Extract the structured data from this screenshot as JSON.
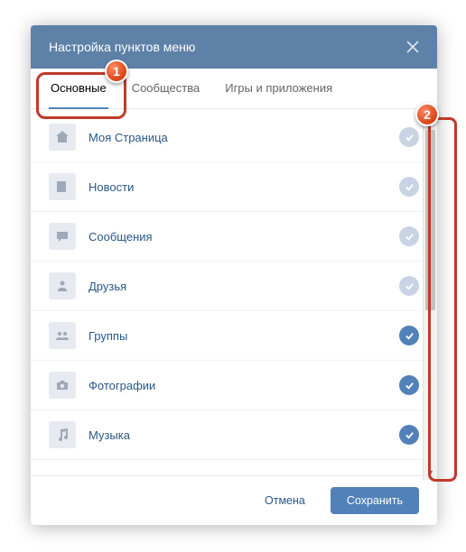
{
  "header": {
    "title": "Настройка пунктов меню"
  },
  "tabs": [
    {
      "label": "Основные",
      "active": true
    },
    {
      "label": "Сообщества",
      "active": false
    },
    {
      "label": "Игры и приложения",
      "active": false
    }
  ],
  "items": [
    {
      "label": "Моя Страница",
      "icon": "home",
      "state": "locked"
    },
    {
      "label": "Новости",
      "icon": "news",
      "state": "locked"
    },
    {
      "label": "Сообщения",
      "icon": "chat",
      "state": "locked"
    },
    {
      "label": "Друзья",
      "icon": "people",
      "state": "locked"
    },
    {
      "label": "Группы",
      "icon": "group",
      "state": "active"
    },
    {
      "label": "Фотографии",
      "icon": "camera",
      "state": "active"
    },
    {
      "label": "Музыка",
      "icon": "music",
      "state": "active"
    }
  ],
  "footer": {
    "cancel": "Отмена",
    "save": "Сохранить"
  },
  "annotations": {
    "pin1": "1",
    "pin2": "2"
  }
}
